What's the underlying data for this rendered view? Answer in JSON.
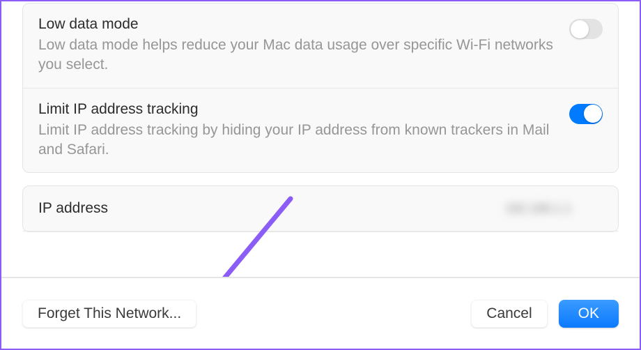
{
  "settings": [
    {
      "title": "Low data mode",
      "description": "Low data mode helps reduce your Mac data usage over specific Wi-Fi networks you select.",
      "enabled": false
    },
    {
      "title": "Limit IP address tracking",
      "description": "Limit IP address tracking by hiding your IP address from known trackers in Mail and Safari.",
      "enabled": true
    }
  ],
  "ip": {
    "label": "IP address",
    "value": "192.168.1.1"
  },
  "footer": {
    "forget_label": "Forget This Network...",
    "cancel_label": "Cancel",
    "ok_label": "OK"
  }
}
